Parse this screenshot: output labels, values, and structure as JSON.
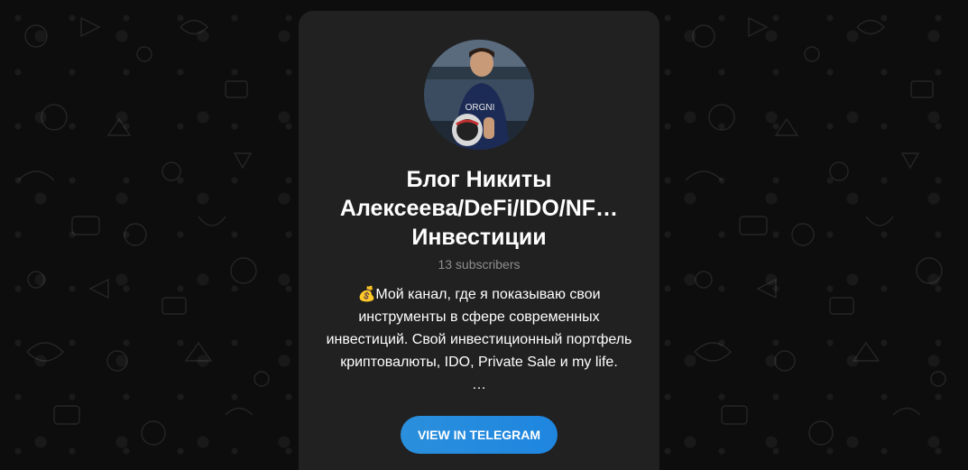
{
  "channel": {
    "title_lines": [
      "Блог Никиты",
      "Алексеева/DeFi/IDO/NF…",
      "Инвестиции"
    ],
    "subscribers": "13 subscribers",
    "description_lines": [
      "💰Мой канал, где я показываю свои",
      "инструменты в сфере современных",
      "инвестиций. Свой инвестиционный портфель",
      "криптовалюты, IDO, Private Sale и my life.",
      "…"
    ],
    "avatar_icon": "channel-avatar-photo"
  },
  "button": {
    "label": "VIEW IN TELEGRAM"
  },
  "colors": {
    "page_background": "#0e0e0e",
    "card_background": "#212121",
    "button_background": "#2481cc",
    "muted_text": "#8d8e90"
  }
}
